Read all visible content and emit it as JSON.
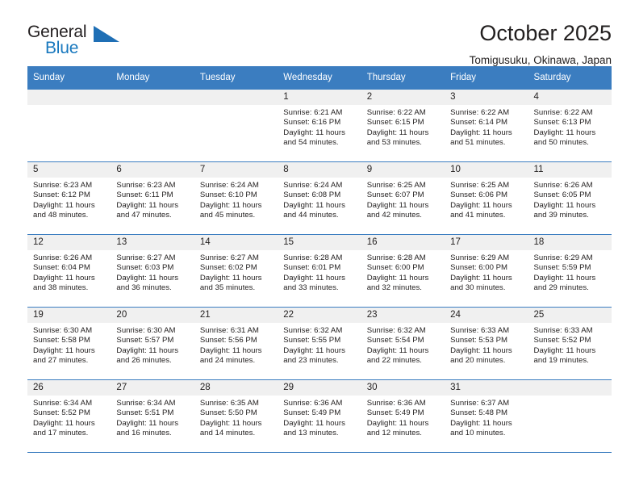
{
  "logo": {
    "primary_text": "General",
    "secondary_text": "Blue",
    "accent_color": "#1878be",
    "triangle_color": "#1f6fb5"
  },
  "header": {
    "title": "October 2025",
    "subtitle": "Tomigusuku, Okinawa, Japan"
  },
  "theme": {
    "header_row_bg": "#3b7dc0",
    "daynum_bg": "#f0f0f0",
    "text_color": "#221f1f"
  },
  "calendar": {
    "weekday_headers": [
      "Sunday",
      "Monday",
      "Tuesday",
      "Wednesday",
      "Thursday",
      "Friday",
      "Saturday"
    ],
    "weeks": [
      [
        {
          "day": "",
          "blank": true,
          "sunrise": "",
          "sunset": "",
          "daylight": ""
        },
        {
          "day": "",
          "blank": true,
          "sunrise": "",
          "sunset": "",
          "daylight": ""
        },
        {
          "day": "",
          "blank": true,
          "sunrise": "",
          "sunset": "",
          "daylight": ""
        },
        {
          "day": "1",
          "blank": false,
          "sunrise": "Sunrise: 6:21 AM",
          "sunset": "Sunset: 6:16 PM",
          "daylight": "Daylight: 11 hours and 54 minutes."
        },
        {
          "day": "2",
          "blank": false,
          "sunrise": "Sunrise: 6:22 AM",
          "sunset": "Sunset: 6:15 PM",
          "daylight": "Daylight: 11 hours and 53 minutes."
        },
        {
          "day": "3",
          "blank": false,
          "sunrise": "Sunrise: 6:22 AM",
          "sunset": "Sunset: 6:14 PM",
          "daylight": "Daylight: 11 hours and 51 minutes."
        },
        {
          "day": "4",
          "blank": false,
          "sunrise": "Sunrise: 6:22 AM",
          "sunset": "Sunset: 6:13 PM",
          "daylight": "Daylight: 11 hours and 50 minutes."
        }
      ],
      [
        {
          "day": "5",
          "blank": false,
          "sunrise": "Sunrise: 6:23 AM",
          "sunset": "Sunset: 6:12 PM",
          "daylight": "Daylight: 11 hours and 48 minutes."
        },
        {
          "day": "6",
          "blank": false,
          "sunrise": "Sunrise: 6:23 AM",
          "sunset": "Sunset: 6:11 PM",
          "daylight": "Daylight: 11 hours and 47 minutes."
        },
        {
          "day": "7",
          "blank": false,
          "sunrise": "Sunrise: 6:24 AM",
          "sunset": "Sunset: 6:10 PM",
          "daylight": "Daylight: 11 hours and 45 minutes."
        },
        {
          "day": "8",
          "blank": false,
          "sunrise": "Sunrise: 6:24 AM",
          "sunset": "Sunset: 6:08 PM",
          "daylight": "Daylight: 11 hours and 44 minutes."
        },
        {
          "day": "9",
          "blank": false,
          "sunrise": "Sunrise: 6:25 AM",
          "sunset": "Sunset: 6:07 PM",
          "daylight": "Daylight: 11 hours and 42 minutes."
        },
        {
          "day": "10",
          "blank": false,
          "sunrise": "Sunrise: 6:25 AM",
          "sunset": "Sunset: 6:06 PM",
          "daylight": "Daylight: 11 hours and 41 minutes."
        },
        {
          "day": "11",
          "blank": false,
          "sunrise": "Sunrise: 6:26 AM",
          "sunset": "Sunset: 6:05 PM",
          "daylight": "Daylight: 11 hours and 39 minutes."
        }
      ],
      [
        {
          "day": "12",
          "blank": false,
          "sunrise": "Sunrise: 6:26 AM",
          "sunset": "Sunset: 6:04 PM",
          "daylight": "Daylight: 11 hours and 38 minutes."
        },
        {
          "day": "13",
          "blank": false,
          "sunrise": "Sunrise: 6:27 AM",
          "sunset": "Sunset: 6:03 PM",
          "daylight": "Daylight: 11 hours and 36 minutes."
        },
        {
          "day": "14",
          "blank": false,
          "sunrise": "Sunrise: 6:27 AM",
          "sunset": "Sunset: 6:02 PM",
          "daylight": "Daylight: 11 hours and 35 minutes."
        },
        {
          "day": "15",
          "blank": false,
          "sunrise": "Sunrise: 6:28 AM",
          "sunset": "Sunset: 6:01 PM",
          "daylight": "Daylight: 11 hours and 33 minutes."
        },
        {
          "day": "16",
          "blank": false,
          "sunrise": "Sunrise: 6:28 AM",
          "sunset": "Sunset: 6:00 PM",
          "daylight": "Daylight: 11 hours and 32 minutes."
        },
        {
          "day": "17",
          "blank": false,
          "sunrise": "Sunrise: 6:29 AM",
          "sunset": "Sunset: 6:00 PM",
          "daylight": "Daylight: 11 hours and 30 minutes."
        },
        {
          "day": "18",
          "blank": false,
          "sunrise": "Sunrise: 6:29 AM",
          "sunset": "Sunset: 5:59 PM",
          "daylight": "Daylight: 11 hours and 29 minutes."
        }
      ],
      [
        {
          "day": "19",
          "blank": false,
          "sunrise": "Sunrise: 6:30 AM",
          "sunset": "Sunset: 5:58 PM",
          "daylight": "Daylight: 11 hours and 27 minutes."
        },
        {
          "day": "20",
          "blank": false,
          "sunrise": "Sunrise: 6:30 AM",
          "sunset": "Sunset: 5:57 PM",
          "daylight": "Daylight: 11 hours and 26 minutes."
        },
        {
          "day": "21",
          "blank": false,
          "sunrise": "Sunrise: 6:31 AM",
          "sunset": "Sunset: 5:56 PM",
          "daylight": "Daylight: 11 hours and 24 minutes."
        },
        {
          "day": "22",
          "blank": false,
          "sunrise": "Sunrise: 6:32 AM",
          "sunset": "Sunset: 5:55 PM",
          "daylight": "Daylight: 11 hours and 23 minutes."
        },
        {
          "day": "23",
          "blank": false,
          "sunrise": "Sunrise: 6:32 AM",
          "sunset": "Sunset: 5:54 PM",
          "daylight": "Daylight: 11 hours and 22 minutes."
        },
        {
          "day": "24",
          "blank": false,
          "sunrise": "Sunrise: 6:33 AM",
          "sunset": "Sunset: 5:53 PM",
          "daylight": "Daylight: 11 hours and 20 minutes."
        },
        {
          "day": "25",
          "blank": false,
          "sunrise": "Sunrise: 6:33 AM",
          "sunset": "Sunset: 5:52 PM",
          "daylight": "Daylight: 11 hours and 19 minutes."
        }
      ],
      [
        {
          "day": "26",
          "blank": false,
          "sunrise": "Sunrise: 6:34 AM",
          "sunset": "Sunset: 5:52 PM",
          "daylight": "Daylight: 11 hours and 17 minutes."
        },
        {
          "day": "27",
          "blank": false,
          "sunrise": "Sunrise: 6:34 AM",
          "sunset": "Sunset: 5:51 PM",
          "daylight": "Daylight: 11 hours and 16 minutes."
        },
        {
          "day": "28",
          "blank": false,
          "sunrise": "Sunrise: 6:35 AM",
          "sunset": "Sunset: 5:50 PM",
          "daylight": "Daylight: 11 hours and 14 minutes."
        },
        {
          "day": "29",
          "blank": false,
          "sunrise": "Sunrise: 6:36 AM",
          "sunset": "Sunset: 5:49 PM",
          "daylight": "Daylight: 11 hours and 13 minutes."
        },
        {
          "day": "30",
          "blank": false,
          "sunrise": "Sunrise: 6:36 AM",
          "sunset": "Sunset: 5:49 PM",
          "daylight": "Daylight: 11 hours and 12 minutes."
        },
        {
          "day": "31",
          "blank": false,
          "sunrise": "Sunrise: 6:37 AM",
          "sunset": "Sunset: 5:48 PM",
          "daylight": "Daylight: 11 hours and 10 minutes."
        },
        {
          "day": "",
          "blank": true,
          "sunrise": "",
          "sunset": "",
          "daylight": ""
        }
      ]
    ]
  }
}
